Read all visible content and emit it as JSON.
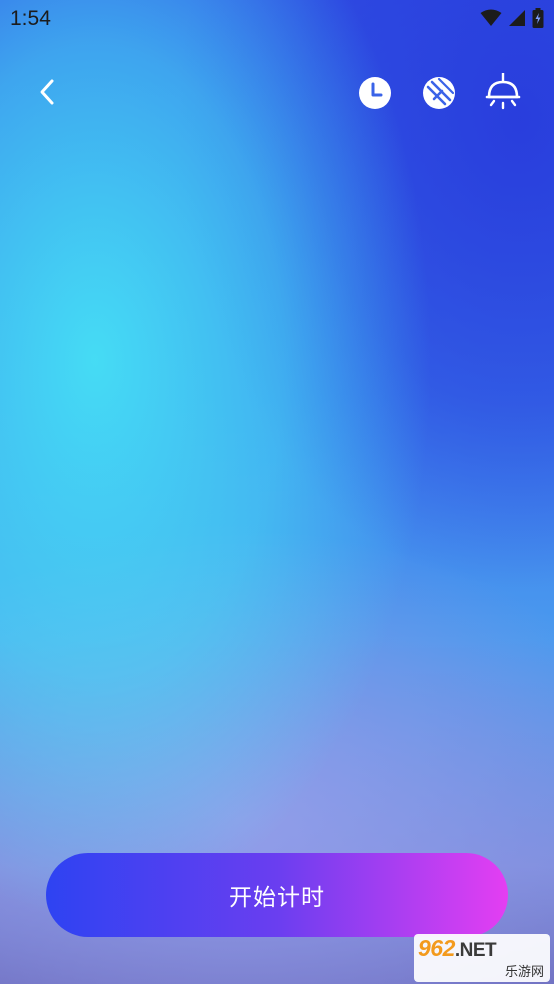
{
  "status_bar": {
    "time": "1:54",
    "icons": [
      "wifi-icon",
      "cellular-signal-icon",
      "battery-icon"
    ]
  },
  "top_bar": {
    "back_icon": "chevron-left-icon",
    "actions": [
      {
        "icon": "clock-icon"
      },
      {
        "icon": "pattern-toggle-icon"
      },
      {
        "icon": "ceiling-lamp-icon"
      }
    ]
  },
  "main": {
    "start_button_label": "开始计时"
  },
  "watermark": {
    "brand_number": "962",
    "brand_suffix": ".NET",
    "site_name": "乐游网"
  },
  "colors": {
    "button_gradient_start": "#2e43f2",
    "button_gradient_end": "#e43ef2",
    "background_top": "#3355e6",
    "background_left_glow": "#46e1f5",
    "icon_color": "#ffffff",
    "watermark_orange": "#f39a1d"
  }
}
